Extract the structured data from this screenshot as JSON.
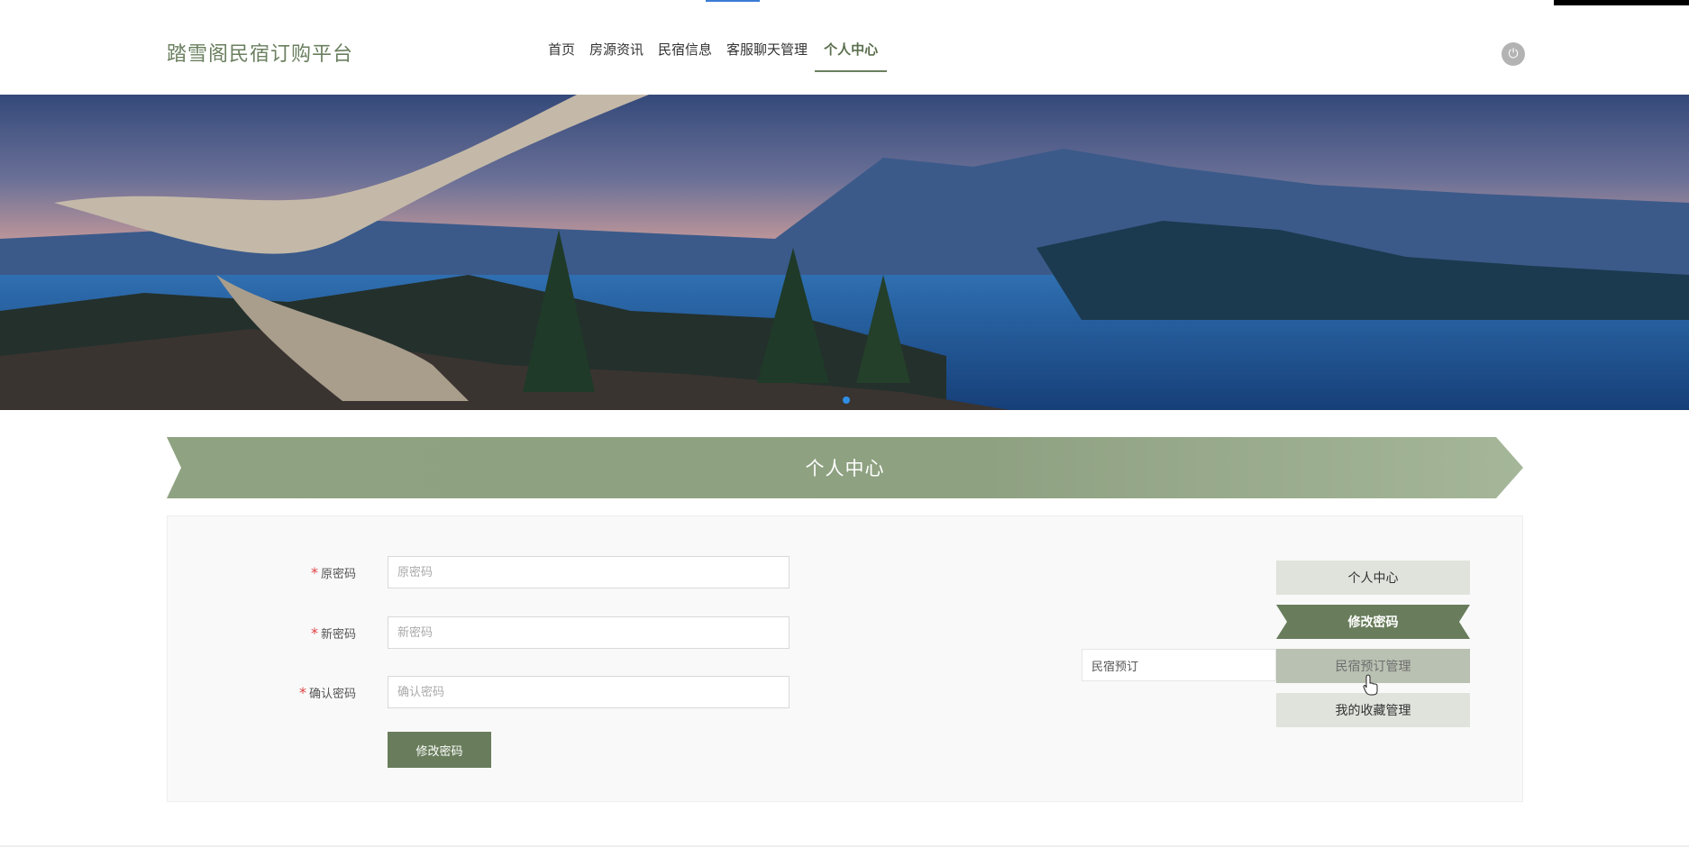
{
  "window": {
    "minimize_icon": "minimize-icon",
    "restore_icon": "restore-icon",
    "close_icon": "close-icon"
  },
  "header": {
    "site_title": "踏雪阁民宿订购平台",
    "nav": [
      {
        "label": "首页"
      },
      {
        "label": "房源资讯"
      },
      {
        "label": "民宿信息"
      },
      {
        "label": "客服聊天管理"
      },
      {
        "label": "个人中心",
        "active": true
      }
    ],
    "power_icon": "power-icon"
  },
  "section": {
    "title": "个人中心"
  },
  "form": {
    "fields": [
      {
        "label": "原密码",
        "placeholder": "原密码",
        "required": true
      },
      {
        "label": "新密码",
        "placeholder": "新密码",
        "required": true
      },
      {
        "label": "确认密码",
        "placeholder": "确认密码",
        "required": true
      }
    ],
    "submit_label": "修改密码"
  },
  "side_menu": {
    "items": [
      {
        "label": "个人中心"
      },
      {
        "label": "修改密码",
        "active": true
      },
      {
        "label": "民宿预订管理",
        "hover": true
      },
      {
        "label": "我的收藏管理"
      }
    ],
    "submenu_item": "民宿预订"
  },
  "colors": {
    "accent": "#697d5c",
    "banner_bar": "#8fa382",
    "side_inactive": "#dfe3dc",
    "side_hover": "#b9c1b2"
  }
}
